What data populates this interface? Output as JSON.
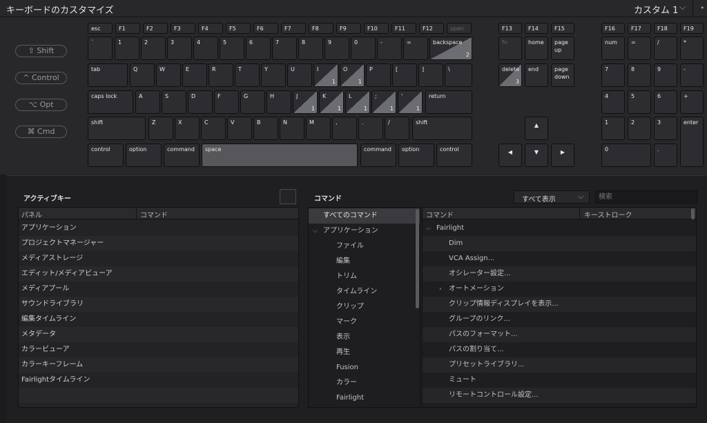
{
  "window": {
    "title": "キーボードのカスタマイズ",
    "preset": "カスタム 1",
    "preset_chevron": "chevron-down-icon",
    "menu_dot": "•"
  },
  "modifiers": [
    {
      "label": "⇧ Shift"
    },
    {
      "label": "^ Control"
    },
    {
      "label": "⌥ Opt"
    },
    {
      "label": "⌘ Cmd"
    }
  ],
  "keys": {
    "esc": "esc",
    "f1": "F1",
    "f2": "F2",
    "f3": "F3",
    "f4": "F4",
    "f5": "F5",
    "f6": "F6",
    "f7": "F7",
    "f8": "F8",
    "f9": "F9",
    "f10": "F10",
    "f11": "F11",
    "f12": "F12",
    "open": "open",
    "f13": "F13",
    "f14": "F14",
    "f15": "F15",
    "f16": "F16",
    "f17": "F17",
    "f18": "F18",
    "f19": "F19",
    "backtick": "`",
    "n1": "1",
    "n2": "2",
    "n3": "3",
    "n4": "4",
    "n5": "5",
    "n6": "6",
    "n7": "7",
    "n8": "8",
    "n9": "9",
    "n0": "0",
    "minus": "-",
    "equals": "=",
    "backspace": "backspace",
    "backspace_badge": "2",
    "fn": "fn",
    "home": "home",
    "pageup": "page\nup",
    "num": "num",
    "kp_eq": "=",
    "kp_slash": "/",
    "kp_star": "*",
    "tab": "tab",
    "q": "Q",
    "w": "W",
    "e": "E",
    "r": "R",
    "t": "T",
    "y": "Y",
    "u": "U",
    "i": "I",
    "i_badge": "1",
    "o": "O",
    "o_badge": "1",
    "p": "P",
    "lbracket": "[",
    "rbracket": "]",
    "backslash": "\\",
    "delete": "delete",
    "delete_badge": "3",
    "end": "end",
    "pagedown": "page\ndown",
    "kp7": "7",
    "kp8": "8",
    "kp9": "9",
    "kp_minus": "-",
    "capslock": "caps lock",
    "a": "A",
    "s": "S",
    "d": "D",
    "f": "F",
    "g": "G",
    "h": "H",
    "j": "J",
    "j_badge": "1",
    "k": "K",
    "k_badge": "1",
    "l": "L",
    "l_badge": "1",
    "semi": ";",
    "semi_badge": "1",
    "quote": "'",
    "quote_badge": "1",
    "return": "return",
    "kp4": "4",
    "kp5": "5",
    "kp6": "6",
    "kp_plus": "+",
    "lshift": "shift",
    "z": "Z",
    "x": "X",
    "c": "C",
    "v": "V",
    "b": "B",
    "n": "N",
    "m": "M",
    "comma": ",",
    "period": ".",
    "slash": "/",
    "rshift": "shift",
    "up": "▲",
    "kp1": "1",
    "kp2": "2",
    "kp3": "3",
    "enter": "enter",
    "lcontrol": "control",
    "loption": "option",
    "lcommand": "command",
    "space": "space",
    "rcommand": "command",
    "roption": "option",
    "rcontrol": "control",
    "left": "◀",
    "down": "▼",
    "right": "▶",
    "kp0": "0",
    "kp_dot": "."
  },
  "active_keys": {
    "title": "アクティブキー",
    "columns": [
      "パネル",
      "コマンド"
    ],
    "rows": [
      "アプリケーション",
      "プロジェクトマネージャー",
      "メディアストレージ",
      "エディット/メディアビューア",
      "メディアプール",
      "サウンドライブラリ",
      "編集タイムライン",
      "メタデータ",
      "カラービューア",
      "カラーキーフレーム",
      "Fairlightタイムライン"
    ]
  },
  "commands": {
    "title": "コマンド",
    "filter": "すべて表示",
    "search_placeholder": "検索",
    "tree": [
      {
        "label": "すべてのコマンド"
      },
      {
        "label": "アプリケーション"
      },
      {
        "label": "ファイル"
      },
      {
        "label": "編集"
      },
      {
        "label": "トリム"
      },
      {
        "label": "タイムライン"
      },
      {
        "label": "クリップ"
      },
      {
        "label": "マーク"
      },
      {
        "label": "表示"
      },
      {
        "label": "再生"
      },
      {
        "label": "Fusion"
      },
      {
        "label": "カラー"
      },
      {
        "label": "Fairlight"
      }
    ],
    "columns": [
      "コマンド",
      "キーストローク"
    ],
    "list": [
      {
        "label": "Fairlight"
      },
      {
        "label": "Dim"
      },
      {
        "label": "VCA Assign..."
      },
      {
        "label": "オシレーター設定..."
      },
      {
        "label": "オートメーション"
      },
      {
        "label": "クリップ情報ディスプレイを表示..."
      },
      {
        "label": "グループのリンク..."
      },
      {
        "label": "パスのフォーマット..."
      },
      {
        "label": "パスの割り当て..."
      },
      {
        "label": "プリセットライブラリ..."
      },
      {
        "label": "ミュート"
      },
      {
        "label": "リモートコントロール設定..."
      }
    ]
  }
}
